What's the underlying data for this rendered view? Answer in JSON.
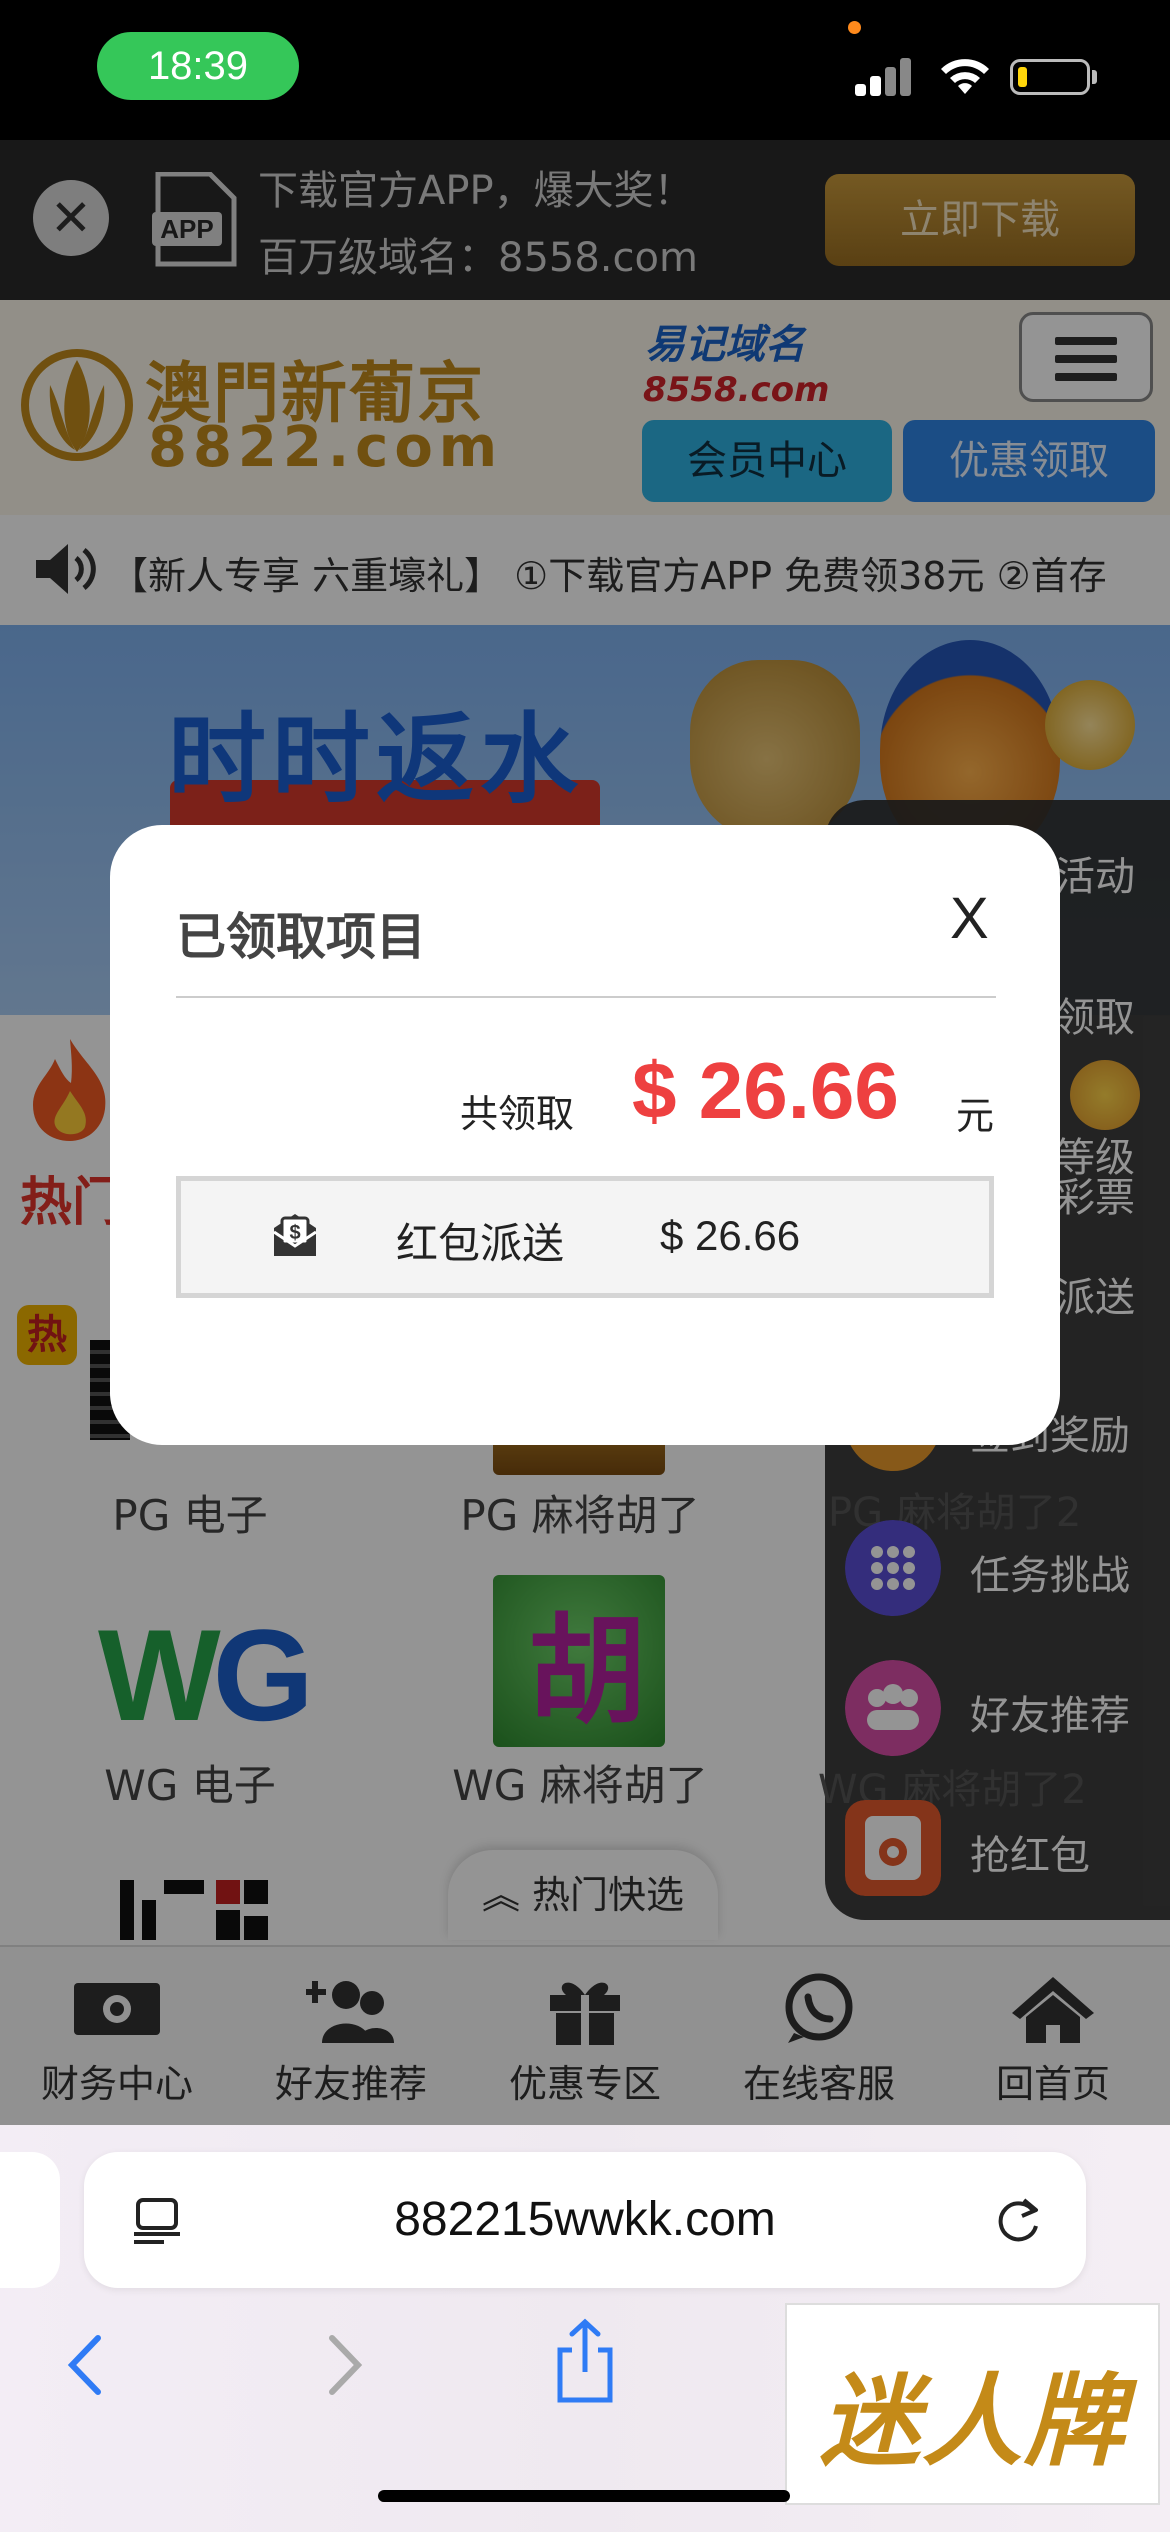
{
  "status_bar": {
    "time": "18:39"
  },
  "download_banner": {
    "close_glyph": "✕",
    "line1": "下载官方APP，爆大奖！",
    "line2": "百万级域名：8558.com",
    "button": "立即下载"
  },
  "header": {
    "logo_line1": "澳門新葡京",
    "logo_line2": "8822.com",
    "domain_hint_1": "易记域名",
    "domain_hint_2": "8558.com",
    "member_button": "会员中心",
    "promo_button": "优惠领取"
  },
  "marquee": {
    "text": "【新人专享 六重壕礼】 ①下载官方APP 免费领38元 ②首存"
  },
  "hero": {
    "title": "时时返水"
  },
  "hot_section": {
    "label": "热门",
    "badge": "热",
    "tiles": [
      "PG 电子",
      "PG 麻将胡了",
      "WG 电子",
      "WG 麻将胡了"
    ],
    "quick_pick": "热门快选",
    "wg_logo_a": "W",
    "wg_logo_b": "G",
    "mahjong_glyph": "胡"
  },
  "side_panel": {
    "items": [
      "活动",
      "领取",
      "等级",
      "彩票",
      "派送",
      "签到奖励",
      "任务挑战",
      "好友推荐",
      "抢红包"
    ],
    "behind_texts": [
      "PG 麻将胡了2",
      "WG 麻将胡了2"
    ]
  },
  "bottom_nav": {
    "items": [
      {
        "label": "财务中心",
        "icon": "cash-icon"
      },
      {
        "label": "好友推荐",
        "icon": "add-friend-icon"
      },
      {
        "label": "优惠专区",
        "icon": "gift-icon"
      },
      {
        "label": "在线客服",
        "icon": "chat-icon"
      },
      {
        "label": "回首页",
        "icon": "home-icon"
      }
    ]
  },
  "modal": {
    "title": "已领取项目",
    "close": "X",
    "total_label": "共领取",
    "total_amount": "$ 26.66",
    "total_unit": "元",
    "records": [
      {
        "name": "红包派送",
        "amount": "$ 26.66",
        "icon": "red-envelope-icon"
      }
    ]
  },
  "browser": {
    "url": "882215wwkk.com"
  },
  "watermark": {
    "text": "迷人牌"
  },
  "colors": {
    "accent_red": "#ee4040",
    "gold": "#c28a1d",
    "status_green": "#35c759"
  }
}
